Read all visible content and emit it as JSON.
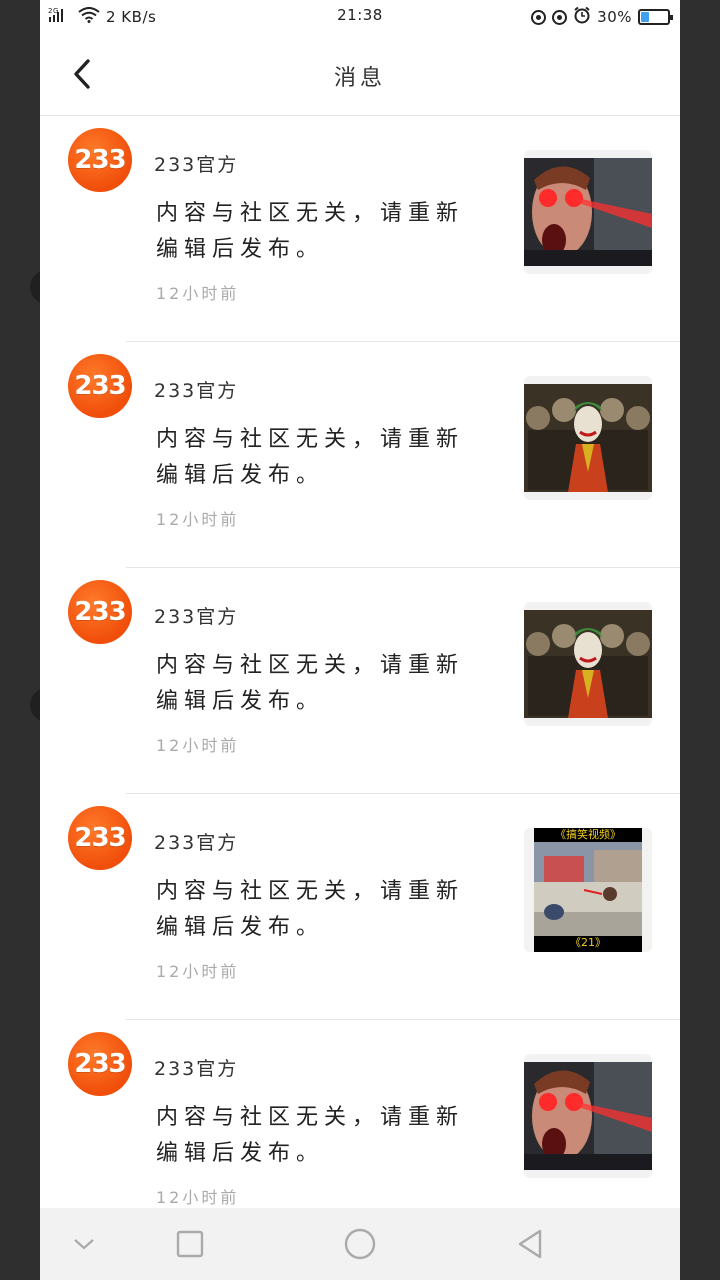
{
  "status_bar": {
    "network": "2G",
    "speed": "2 KB/s",
    "time": "21:38",
    "battery": "30%",
    "battery_level": 0.3,
    "icons": [
      "signal-icon",
      "wifi-icon",
      "eye-care-icon",
      "lock-rotation-icon",
      "alarm-icon",
      "battery-icon"
    ]
  },
  "header": {
    "title": "消息",
    "back_icon": "chevron-left-icon"
  },
  "messages": [
    {
      "avatar_text": "233",
      "sender": "233官方",
      "content": "内容与社区无关，请重新编辑后发布。",
      "time": "12小时前",
      "thumb": "man-laser-eyes"
    },
    {
      "avatar_text": "233",
      "sender": "233官方",
      "content": "内容与社区无关，请重新编辑后发布。",
      "time": "12小时前",
      "thumb": "joker-crowd"
    },
    {
      "avatar_text": "233",
      "sender": "233官方",
      "content": "内容与社区无关，请重新编辑后发布。",
      "time": "12小时前",
      "thumb": "joker-crowd"
    },
    {
      "avatar_text": "233",
      "sender": "233官方",
      "content": "内容与社区无关，请重新编辑后发布。",
      "time": "12小时前",
      "thumb": "funny-video",
      "thumb_caption_top": "《搞笑视频》",
      "thumb_caption_bottom": "《21》"
    },
    {
      "avatar_text": "233",
      "sender": "233官方",
      "content": "内容与社区无关，请重新编辑后发布。",
      "time": "12小时前",
      "thumb": "man-laser-eyes"
    }
  ],
  "nav_bar": {
    "icons": [
      "chevron-down-icon",
      "recents-square-icon",
      "home-circle-icon",
      "back-triangle-icon"
    ]
  },
  "colors": {
    "brand": "#f04e0a",
    "page_bg": "#ffffff",
    "nav_bg": "#f2f2f2"
  }
}
